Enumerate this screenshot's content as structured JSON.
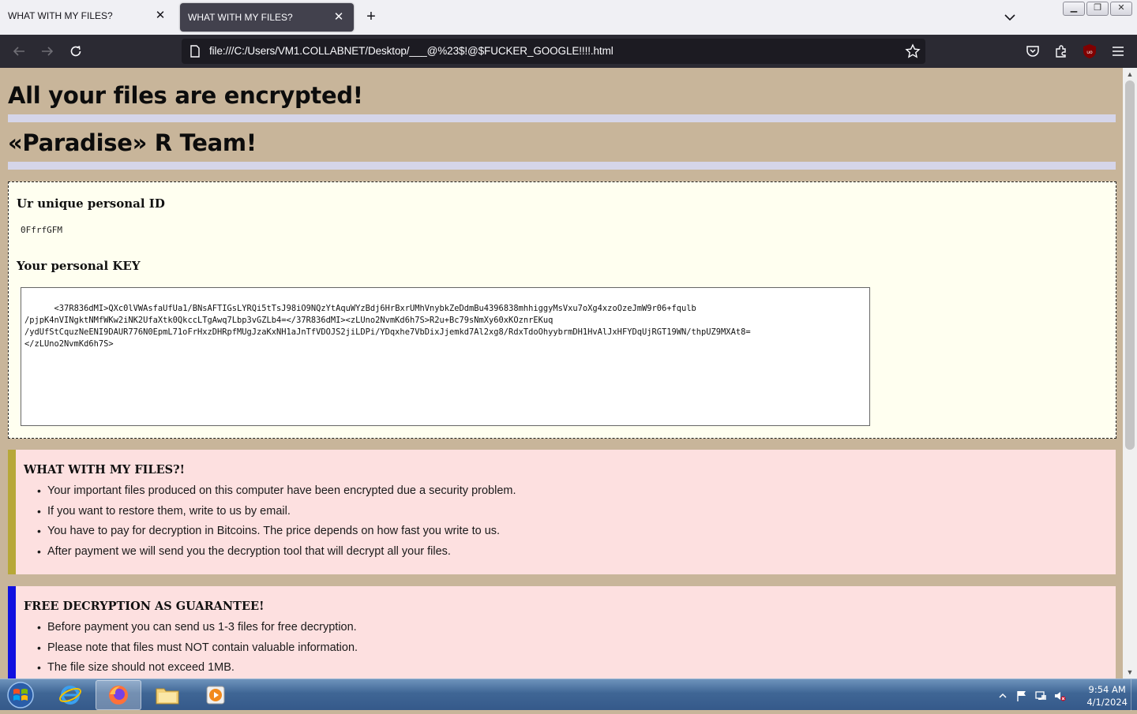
{
  "browser": {
    "tabs": [
      {
        "title": "WHAT WITH MY FILES?",
        "active": false
      },
      {
        "title": "WHAT WITH MY FILES?",
        "active": true
      }
    ],
    "url": "file:///C:/Users/VM1.COLLABNET/Desktop/___@%23$!@$FUCKER_GOOGLE!!!!.html",
    "icons": {
      "back": "back-arrow-icon",
      "forward": "forward-arrow-icon",
      "reload": "reload-icon",
      "page": "page-icon",
      "bookmark": "star-icon",
      "pocket": "pocket-icon",
      "extensions": "puzzle-icon",
      "ublock": "ublock-icon",
      "menu": "hamburger-icon"
    }
  },
  "page": {
    "heading1": "All your files are encrypted!",
    "heading2": "«Paradise» R Team!",
    "id_label": "Ur unique personal ID",
    "id_value": "0FfrfGFM",
    "key_label": "Your personal KEY",
    "key_text": "<37R836dMI>QXc0lVWAsfaUfUa1/BNsAFTIGsLYRQi5tTsJ98iO9NQzYtAquWYzBdj6HrBxrUMhVnybkZeDdmBu4396838mhhiggyMsVxu7oXg4xzoOzeJmW9r06+fqulb\n/pjpK4nVINgktNMfWKw2iNK2UfaXtk0QkccLTgAwq7Lbp3vGZLb4=</37R836dMI><zLUno2NvmKd6h7S>R2u+Bc79sNmXy60xKOznrEKuq\n/ydUfStCquzNeENI9DAUR776N0EpmL71oFrHxzDHRpfMUgJzaKxNH1aJnTfVDOJS2jiLDPi/YDqxhe7VbDixJjemkd7Al2xg8/RdxTdoOhyybrmDH1HvAlJxHFYDqUjRGT19WN/thpUZ9MXAt8=\n</zLUno2NvmKd6h7S>",
    "sections": [
      {
        "title": "WHAT WITH MY FILES?!",
        "accent": "#b7a838",
        "items": [
          "Your important files produced on this computer have been encrypted due a security problem.",
          "If you want to restore them, write to us by email.",
          "You have to pay for decryption in Bitcoins. The price depends on how fast you write to us.",
          "After payment we will send you the decryption tool that will decrypt all your files."
        ]
      },
      {
        "title": "FREE DECRYPTION AS GUARANTEE!",
        "accent": "#1010e0",
        "items": [
          "Before payment you can send us 1-3 files for free decryption.",
          "Please note that files must NOT contain valuable information.",
          "The file size should not exceed 1MB."
        ]
      }
    ]
  },
  "taskbar": {
    "apps": [
      "internet-explorer-icon",
      "firefox-icon",
      "file-explorer-icon",
      "media-player-icon"
    ],
    "time": "9:54 AM",
    "date": "4/1/2024"
  },
  "colors": {
    "page_bg": "#c8b59a",
    "hr": "#d5d5e9",
    "idbox_bg": "#fffff0",
    "note_bg": "#fde0e0"
  }
}
